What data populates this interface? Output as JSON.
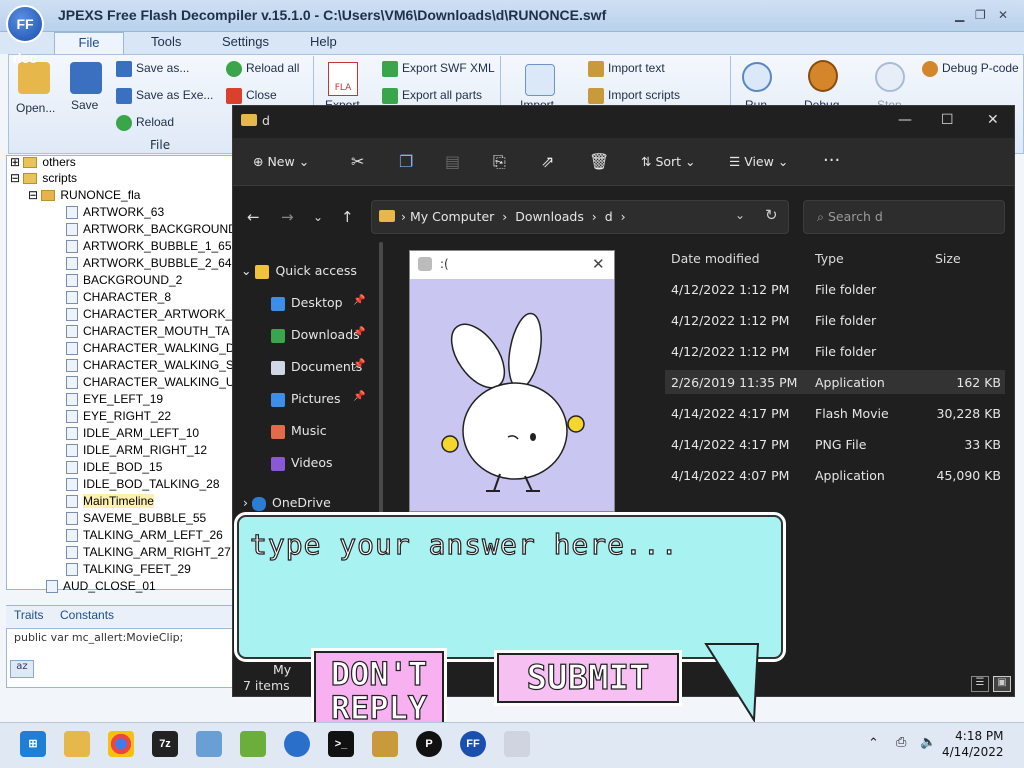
{
  "jpexs": {
    "logo": "FF dec",
    "title": "JPEXS Free Flash Decompiler v.15.1.0 - C:\\Users\\VM6\\Downloads\\d\\RUNONCE.swf",
    "menu": [
      "File",
      "Tools",
      "Settings",
      "Help"
    ],
    "ribbon": {
      "open": "Open...",
      "save": "Save",
      "save_as": "Save as...",
      "save_as_exe": "Save as Exe...",
      "reload": "Reload",
      "reload_all": "Reload all",
      "close": "Close",
      "group_file": "File",
      "fla": "FLA",
      "export_label": "Export",
      "export_swf_xml": "Export SWF XML",
      "export_all_parts": "Export all parts",
      "import_label": "Import",
      "import_text": "Import text",
      "import_scripts": "Import scripts",
      "run": "Run",
      "debug": "Debug",
      "stop": "Stop",
      "debug_pcode": "Debug P-code"
    },
    "tree": {
      "others": "others",
      "scripts": "scripts",
      "runonce": "RUNONCE_fla",
      "items": [
        "ARTWORK_63",
        "ARTWORK_BACKGROUND",
        "ARTWORK_BUBBLE_1_65",
        "ARTWORK_BUBBLE_2_64",
        "BACKGROUND_2",
        "CHARACTER_8",
        "CHARACTER_ARTWORK_",
        "CHARACTER_MOUTH_TA",
        "CHARACTER_WALKING_D",
        "CHARACTER_WALKING_S",
        "CHARACTER_WALKING_U",
        "EYE_LEFT_19",
        "EYE_RIGHT_22",
        "IDLE_ARM_LEFT_10",
        "IDLE_ARM_RIGHT_12",
        "IDLE_BOD_15",
        "IDLE_BOD_TALKING_28",
        "MainTimeline",
        "SAVEME_BUBBLE_55",
        "TALKING_ARM_LEFT_26",
        "TALKING_ARM_RIGHT_27",
        "TALKING_FEET_29"
      ],
      "aud": "AUD_CLOSE_01"
    },
    "tabs": [
      "Traits",
      "Constants"
    ],
    "traits_line": "public var mc_allert:MovieClip;"
  },
  "explorer": {
    "title": "d",
    "toolbar": {
      "new": "New",
      "sort": "Sort",
      "view": "View"
    },
    "breadcrumb": [
      "My Computer",
      "Downloads",
      "d"
    ],
    "search_placeholder": "Search d",
    "nav": {
      "quick_access": "Quick access",
      "items": [
        "Desktop",
        "Downloads",
        "Documents",
        "Pictures",
        "Music",
        "Videos"
      ],
      "onedrive": "OneDrive",
      "partial": "My"
    },
    "columns": [
      "Date modified",
      "Type",
      "Size"
    ],
    "rows": [
      {
        "date": "4/12/2022 1:12 PM",
        "type": "File folder",
        "size": ""
      },
      {
        "date": "4/12/2022 1:12 PM",
        "type": "File folder",
        "size": ""
      },
      {
        "date": "4/12/2022 1:12 PM",
        "type": "File folder",
        "size": ""
      },
      {
        "date": "2/26/2019 11:35 PM",
        "type": "Application",
        "size": "162 KB"
      },
      {
        "date": "4/14/2022 4:17 PM",
        "type": "Flash Movie",
        "size": "30,228 KB"
      },
      {
        "date": "4/14/2022 4:17 PM",
        "type": "PNG File",
        "size": "33 KB"
      },
      {
        "date": "4/14/2022 4:07 PM",
        "type": "Application",
        "size": "45,090 KB"
      }
    ],
    "status": "7 items"
  },
  "popup": {
    "title": ":("
  },
  "game": {
    "answer_placeholder": "type your answer here...",
    "dont_reply": "DON'T REPLY",
    "submit": "SUBMIT"
  },
  "taskbar": {
    "apps": [
      "start",
      "file-explorer",
      "chrome",
      "7z",
      "image-viewer",
      "notepad",
      "network",
      "terminal",
      "package",
      "p-app",
      "ffdec",
      "bunny-app"
    ],
    "time": "4:18 PM",
    "date": "4/14/2022"
  }
}
